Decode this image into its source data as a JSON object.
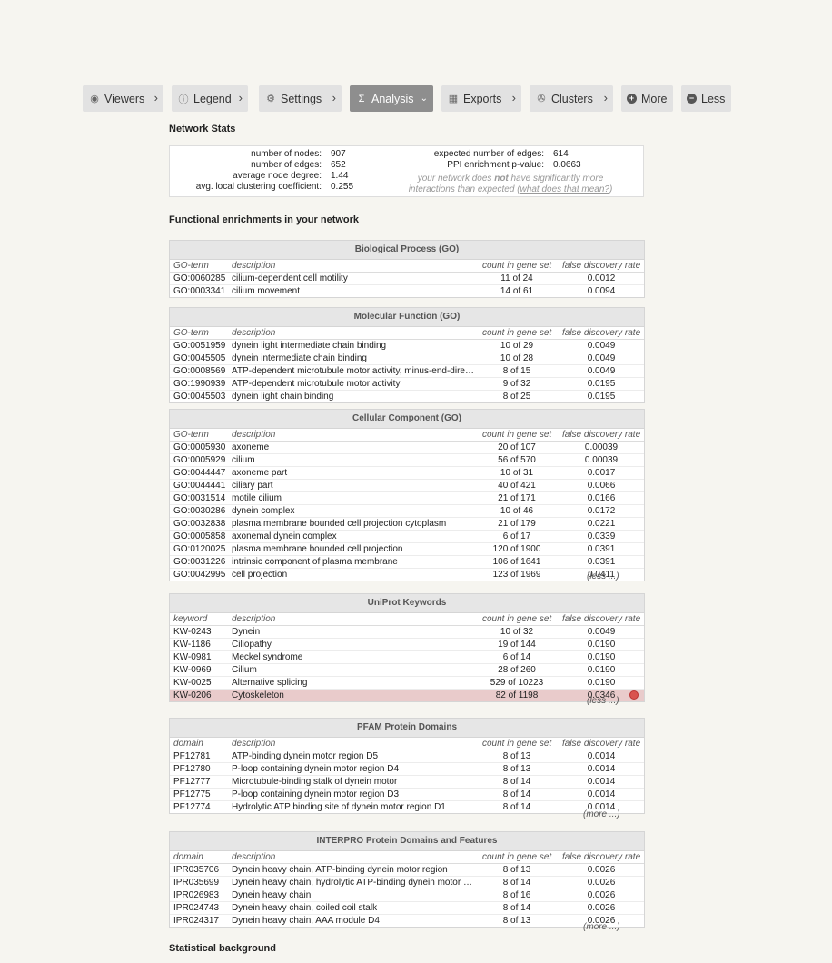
{
  "toolbar": {
    "viewers": "Viewers",
    "legend": "Legend",
    "settings": "Settings",
    "analysis": "Analysis",
    "exports": "Exports",
    "clusters": "Clusters",
    "more": "More",
    "less": "Less"
  },
  "network_stats": {
    "heading": "Network Stats",
    "nodes_label": "number of nodes:",
    "nodes": "907",
    "edges_label": "number of edges:",
    "edges": "652",
    "degree_label": "average node degree:",
    "degree": "1.44",
    "clust_label": "avg. local clustering coefficient:",
    "clust": "0.255",
    "exp_edges_label": "expected number of edges:",
    "exp_edges": "614",
    "ppi_label": "PPI enrichment p-value:",
    "ppi": "0.0663",
    "note_pre": "your network does ",
    "note_not": "not",
    "note_mid": " have significantly more interactions than expected (",
    "note_link": "what does that mean?",
    "note_end": ")"
  },
  "enrich_heading": "Functional enrichments in your network",
  "stat_heading": "Statistical background",
  "headers": {
    "go": "GO-term",
    "kw": "keyword",
    "dom": "domain",
    "desc": "description",
    "count": "count in gene set",
    "fdr": "false discovery rate"
  },
  "tables": {
    "bp": {
      "title": "Biological Process (GO)",
      "rows": [
        [
          "GO:0060285",
          "cilium-dependent cell motility",
          "11 of 24",
          "0.0012"
        ],
        [
          "GO:0003341",
          "cilium movement",
          "14 of 61",
          "0.0094"
        ]
      ]
    },
    "mf": {
      "title": "Molecular Function (GO)",
      "rows": [
        [
          "GO:0051959",
          "dynein light intermediate chain binding",
          "10 of 29",
          "0.0049"
        ],
        [
          "GO:0045505",
          "dynein intermediate chain binding",
          "10 of 28",
          "0.0049"
        ],
        [
          "GO:0008569",
          "ATP-dependent microtubule motor activity, minus-end-dire…",
          "8 of 15",
          "0.0049"
        ],
        [
          "GO:1990939",
          "ATP-dependent microtubule motor activity",
          "9 of 32",
          "0.0195"
        ],
        [
          "GO:0045503",
          "dynein light chain binding",
          "8 of 25",
          "0.0195"
        ]
      ]
    },
    "cc": {
      "title": "Cellular Component (GO)",
      "more": "(less ...)",
      "rows": [
        [
          "GO:0005930",
          "axoneme",
          "20 of 107",
          "0.00039"
        ],
        [
          "GO:0005929",
          "cilium",
          "56 of 570",
          "0.00039"
        ],
        [
          "GO:0044447",
          "axoneme part",
          "10 of 31",
          "0.0017"
        ],
        [
          "GO:0044441",
          "ciliary part",
          "40 of 421",
          "0.0066"
        ],
        [
          "GO:0031514",
          "motile cilium",
          "21 of 171",
          "0.0166"
        ],
        [
          "GO:0030286",
          "dynein complex",
          "10 of 46",
          "0.0172"
        ],
        [
          "GO:0032838",
          "plasma membrane bounded cell projection cytoplasm",
          "21 of 179",
          "0.0221"
        ],
        [
          "GO:0005858",
          "axonemal dynein complex",
          "6 of 17",
          "0.0339"
        ],
        [
          "GO:0120025",
          "plasma membrane bounded cell projection",
          "120 of 1900",
          "0.0391"
        ],
        [
          "GO:0031226",
          "intrinsic component of plasma membrane",
          "106 of 1641",
          "0.0391"
        ],
        [
          "GO:0042995",
          "cell projection",
          "123 of 1969",
          "0.0411"
        ]
      ]
    },
    "kw": {
      "title": "UniProt Keywords",
      "more": "(less ...)",
      "rows": [
        [
          "KW-0243",
          "Dynein",
          "10 of 32",
          "0.0049"
        ],
        [
          "KW-1186",
          "Ciliopathy",
          "19 of 144",
          "0.0190"
        ],
        [
          "KW-0981",
          "Meckel syndrome",
          "6 of 14",
          "0.0190"
        ],
        [
          "KW-0969",
          "Cilium",
          "28 of 260",
          "0.0190"
        ],
        [
          "KW-0025",
          "Alternative splicing",
          "529 of 10223",
          "0.0190"
        ],
        [
          "KW-0206",
          "Cytoskeleton",
          "82 of 1198",
          "0.0346"
        ]
      ]
    },
    "pfam": {
      "title": "PFAM Protein Domains",
      "more": "(more ...)",
      "rows": [
        [
          "PF12781",
          "ATP-binding dynein motor region D5",
          "8 of 13",
          "0.0014"
        ],
        [
          "PF12780",
          "P-loop containing dynein motor region D4",
          "8 of 13",
          "0.0014"
        ],
        [
          "PF12777",
          "Microtubule-binding stalk of dynein motor",
          "8 of 14",
          "0.0014"
        ],
        [
          "PF12775",
          "P-loop containing dynein motor region D3",
          "8 of 14",
          "0.0014"
        ],
        [
          "PF12774",
          "Hydrolytic ATP binding site of dynein motor region D1",
          "8 of 14",
          "0.0014"
        ]
      ]
    },
    "ipr": {
      "title": "INTERPRO Protein Domains and Features",
      "more": "(more ...)",
      "rows": [
        [
          "IPR035706",
          "Dynein heavy chain, ATP-binding dynein motor region",
          "8 of 13",
          "0.0026"
        ],
        [
          "IPR035699",
          "Dynein heavy chain, hydrolytic ATP-binding dynein motor re…",
          "8 of 14",
          "0.0026"
        ],
        [
          "IPR026983",
          "Dynein heavy chain",
          "8 of 16",
          "0.0026"
        ],
        [
          "IPR024743",
          "Dynein heavy chain, coiled coil stalk",
          "8 of 14",
          "0.0026"
        ],
        [
          "IPR024317",
          "Dynein heavy chain, AAA module D4",
          "8 of 13",
          "0.0026"
        ]
      ]
    }
  }
}
